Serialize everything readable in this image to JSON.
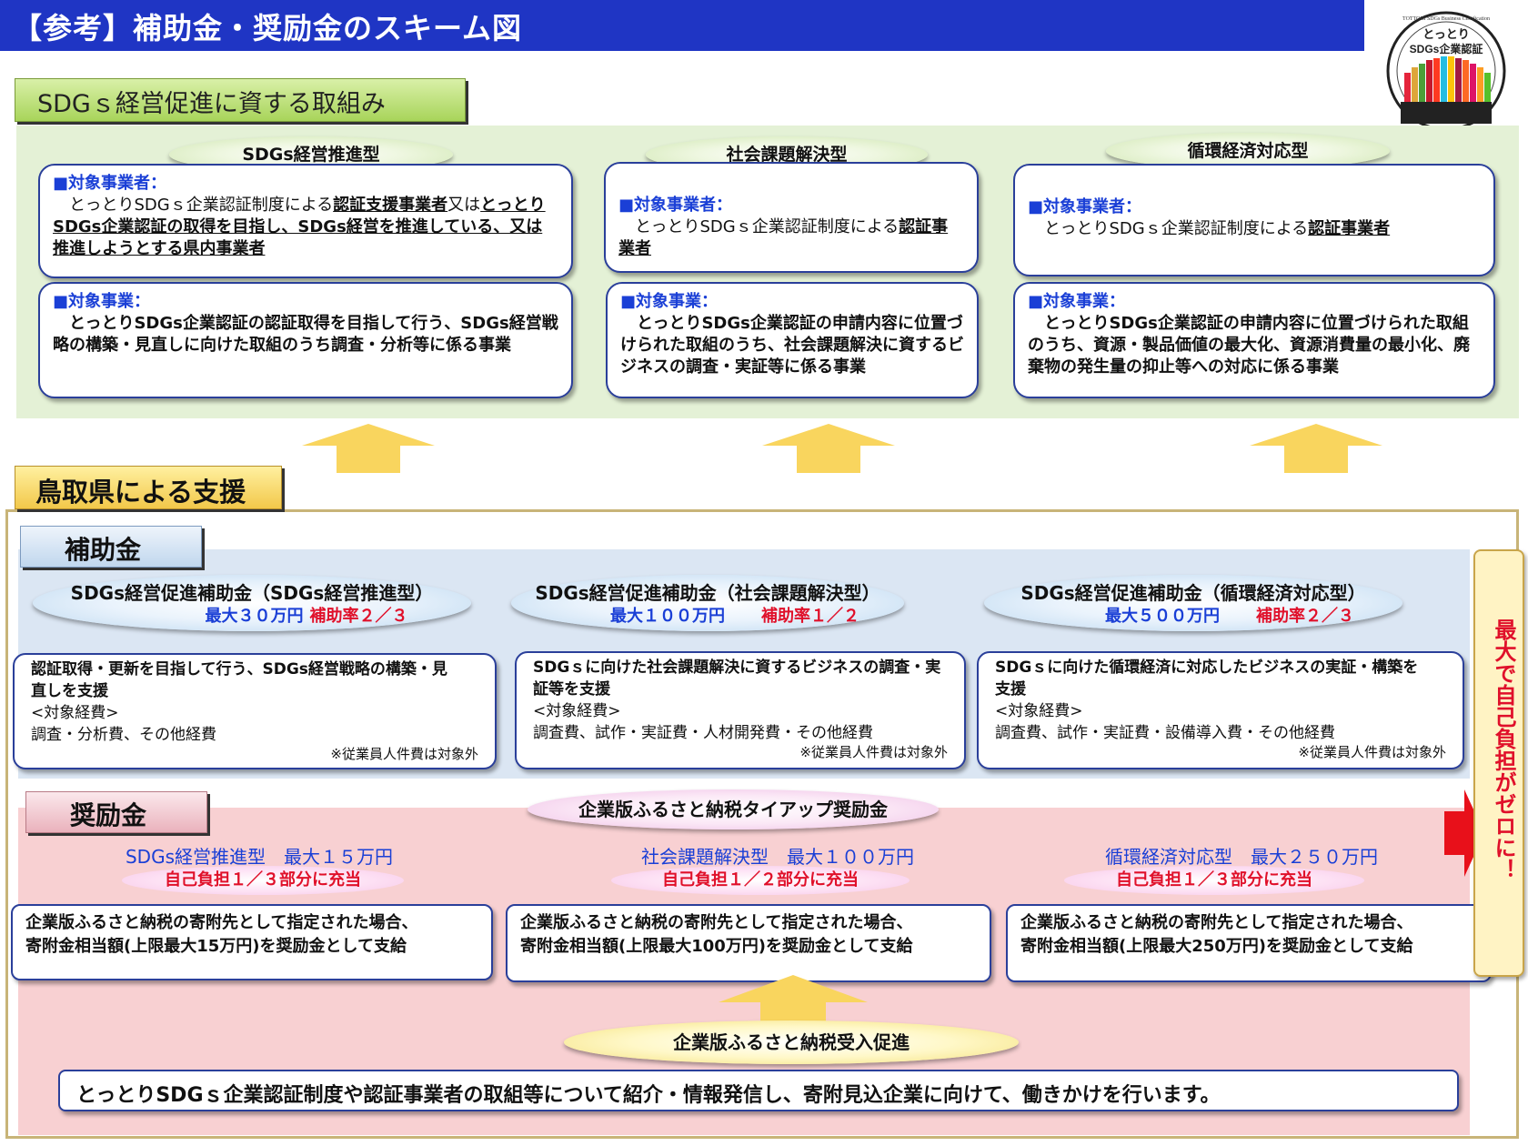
{
  "header": {
    "title": "【参考】補助金・奨励金のスキーム図"
  },
  "logo": {
    "line1": "とっとり",
    "line2": "SDGs企業認証",
    "ring_text": "TOTTORI SDGs Business Certification"
  },
  "sdgs_section": {
    "label": "SDGｓ経営促進に資する取組み",
    "columns": [
      {
        "type": "SDGs経営推進型",
        "target_heading": "対象事業者：",
        "target_body": [
          {
            "t": "　とっとりSDGｓ企業認証制度による",
            "s": "n"
          },
          {
            "t": "認証支援事業者",
            "s": "u"
          },
          {
            "t": "又は",
            "s": "n"
          },
          {
            "t": "とっとりSDGs企業認証の取得を目指し、SDGs経営を推進している、又は推進しようとする県内事業者",
            "s": "u"
          }
        ],
        "business_heading": "対象事業：",
        "business_body": "　とっとりSDGs企業認証の認証取得を目指して行う、SDGs経営戦略の構築・見直しに向けた取組のうち調査・分析等に係る事業"
      },
      {
        "type": "社会課題解決型",
        "target_heading": "対象事業者：",
        "target_body": [
          {
            "t": "　とっとりSDGｓ企業認証制度による",
            "s": "n"
          },
          {
            "t": "認証事業者",
            "s": "u"
          }
        ],
        "business_heading": "対象事業：",
        "business_body": "　とっとりSDGs企業認証の申請内容に位置づけられた取組のうち、社会課題解決に資するビジネスの調査・実証等に係る事業"
      },
      {
        "type": "循環経済対応型",
        "target_heading": "対象事業者：",
        "target_body": [
          {
            "t": "　とっとりSDGｓ企業認証制度による",
            "s": "n"
          },
          {
            "t": "認証事業者",
            "s": "u"
          }
        ],
        "business_heading": "対象事業：",
        "business_body": "　とっとりSDGs企業認証の申請内容に位置づけられた取組のうち、資源・製品価値の最大化、資源消費量の最小化、廃棄物の発生量の抑止等への対応に係る事業"
      }
    ]
  },
  "support": {
    "label": "鳥取県による支援",
    "hojokin": {
      "label": "補助金",
      "items": [
        {
          "title": "SDGs経営促進補助金（SDGs経営推進型）",
          "max": "最大３０万円",
          "rate": "補助率２／３",
          "desc": "認証取得・更新を目指して行う、SDGs経営戦略の構築・見直しを支援",
          "cost_label": "<対象経費>",
          "cost": "調査・分析費、その他経費",
          "note": "※従業員人件費は対象外"
        },
        {
          "title": "SDGs経営促進補助金（社会課題解決型）",
          "max": "最大１００万円",
          "rate": "補助率１／２",
          "desc": "SDGｓに向けた社会課題解決に資するビジネスの調査・実証等を支援",
          "cost_label": "<対象経費>",
          "cost": "調査費、試作・実証費・人材開発費・その他経費",
          "note": "※従業員人件費は対象外"
        },
        {
          "title": "SDGs経営促進補助金（循環経済対応型）",
          "max": "最大５００万円",
          "rate": "補助率２／３",
          "desc": "SDGｓに向けた循環経済に対応したビジネスの実証・構築を支援",
          "cost_label": "<対象経費>",
          "cost": "調査費、試作・実証費・設備導入費・その他経費",
          "note": "※従業員人件費は対象外"
        }
      ]
    },
    "shoreikin": {
      "label": "奨励金",
      "title": "企業版ふるさと納税タイアップ奨励金",
      "items": [
        {
          "name": "SDGs経営推進型　最大１５万円",
          "self": "自己負担１／３部分に充当",
          "line1": "企業版ふるさと納税の寄附先として指定された場合、",
          "line2": "寄附金相当額(上限最大15万円)を奨励金として支給"
        },
        {
          "name": "社会課題解決型　最大１００万円",
          "self": "自己負担１／２部分に充当",
          "line1": "企業版ふるさと納税の寄附先として指定された場合、",
          "line2": "寄附金相当額(上限最大100万円)を奨励金として支給"
        },
        {
          "name": "循環経済対応型　最大２５０万円",
          "self": "自己負担１／３部分に充当",
          "line1": "企業版ふるさと納税の寄附先として指定された場合、",
          "line2": "寄附金相当額(上限最大250万円)を奨励金として支給"
        }
      ]
    },
    "promotion": {
      "title": "企業版ふるさと納税受入促進",
      "body": "とっとりSDGｓ企業認証制度や認証事業者の取組等について紹介・情報発信し、寄附見込企業に向けて、働きかけを行います。"
    },
    "side_note": "最大で自己負担がゼロに！"
  },
  "colors": {
    "header": "#1f35c4",
    "accent_blue": "#1a3fd6",
    "accent_red": "#e0102a",
    "green_panel": "#e4f1d6",
    "blue_panel": "#dbe6f3",
    "pink_panel": "#f8d0d2",
    "arrow": "#f9d55e"
  }
}
